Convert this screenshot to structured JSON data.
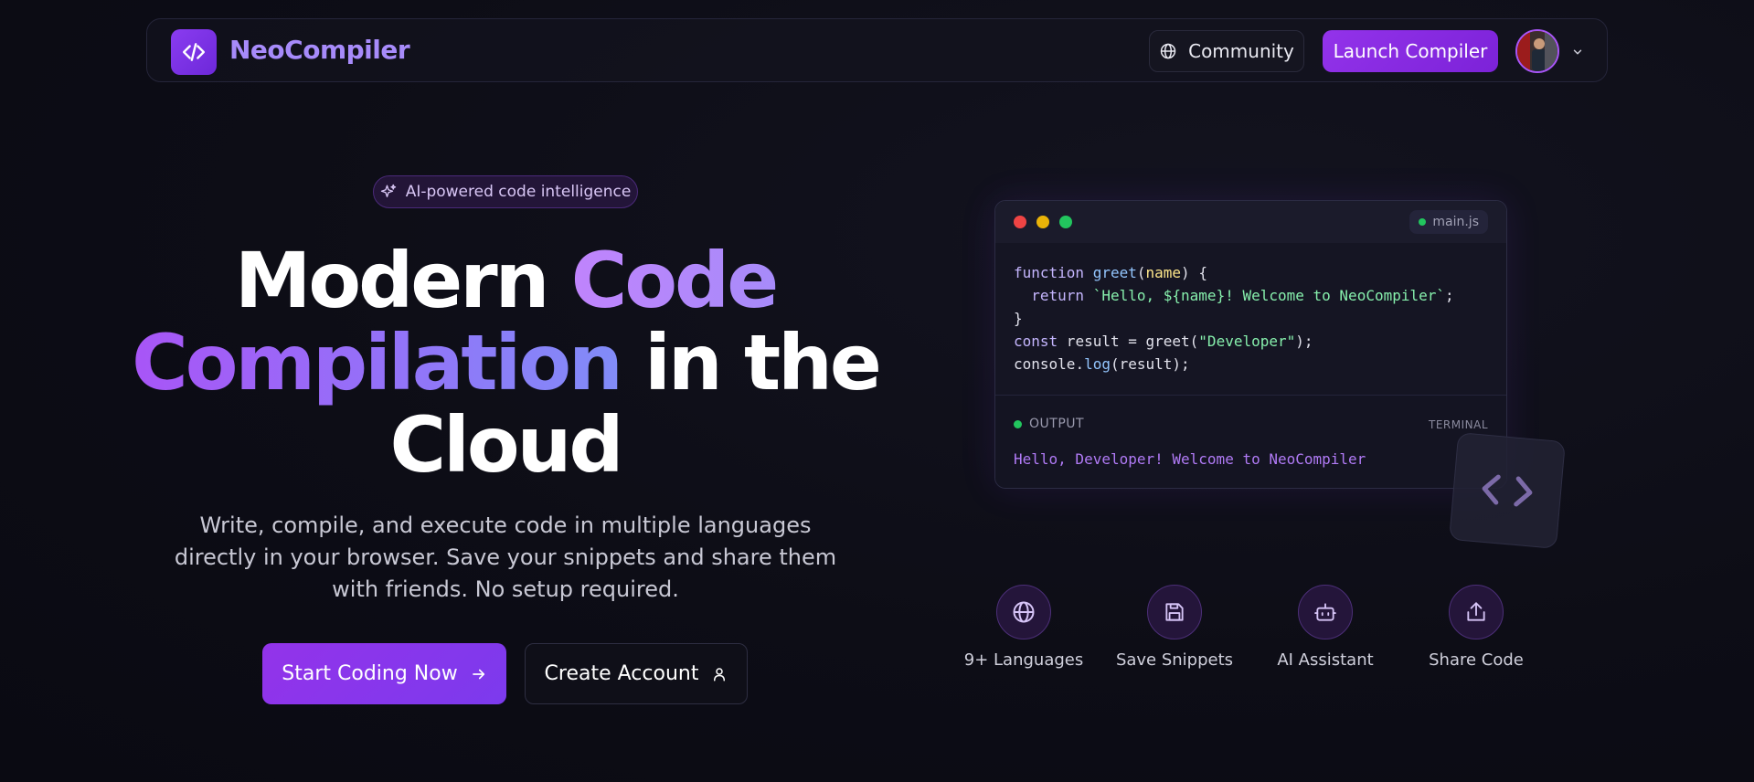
{
  "nav": {
    "brand": "NeoCompiler",
    "community_label": "Community",
    "launch_label": "Launch Compiler",
    "avatar_icon": "user-avatar",
    "chevron_icon": "chevron-down-icon"
  },
  "hero": {
    "badge": "AI-powered code intelligence",
    "title_part1": "Modern ",
    "title_part2": "Code",
    "title_part3": "Compilation",
    "title_part4": " in the",
    "title_part5": "Cloud",
    "subtitle": "Write, compile, and execute code in multiple languages directly in your browser. Save your snippets and share them with friends. No setup required.",
    "start_label": "Start Coding Now",
    "create_label": "Create Account"
  },
  "editor": {
    "filename": "main.js",
    "code": {
      "l1_kw": "function",
      "l1_fn": "greet",
      "l1_pa": "name",
      "l2_kw": "return",
      "l2_st": "`Hello, ${name}! Welcome to NeoCompiler`",
      "l3": "}",
      "l4_kw": "const",
      "l4_rest": " result = greet(",
      "l4_st": "\"Developer\"",
      "l5_obj": "console",
      "l5_me": "log",
      "l5_rest": "(result);"
    },
    "output_label": "OUTPUT",
    "terminal_label": "TERMINAL",
    "output_text": "Hello, Developer! Welcome to NeoCompiler"
  },
  "features": [
    {
      "label": "9+ Languages",
      "icon": "globe-icon"
    },
    {
      "label": "Save Snippets",
      "icon": "save-icon"
    },
    {
      "label": "AI Assistant",
      "icon": "bot-icon"
    },
    {
      "label": "Share Code",
      "icon": "share-icon"
    }
  ],
  "colors": {
    "accent": "#9333ea",
    "accent_light": "#a78bfa",
    "background": "#0d0d16",
    "output_text": "#b07af5"
  }
}
